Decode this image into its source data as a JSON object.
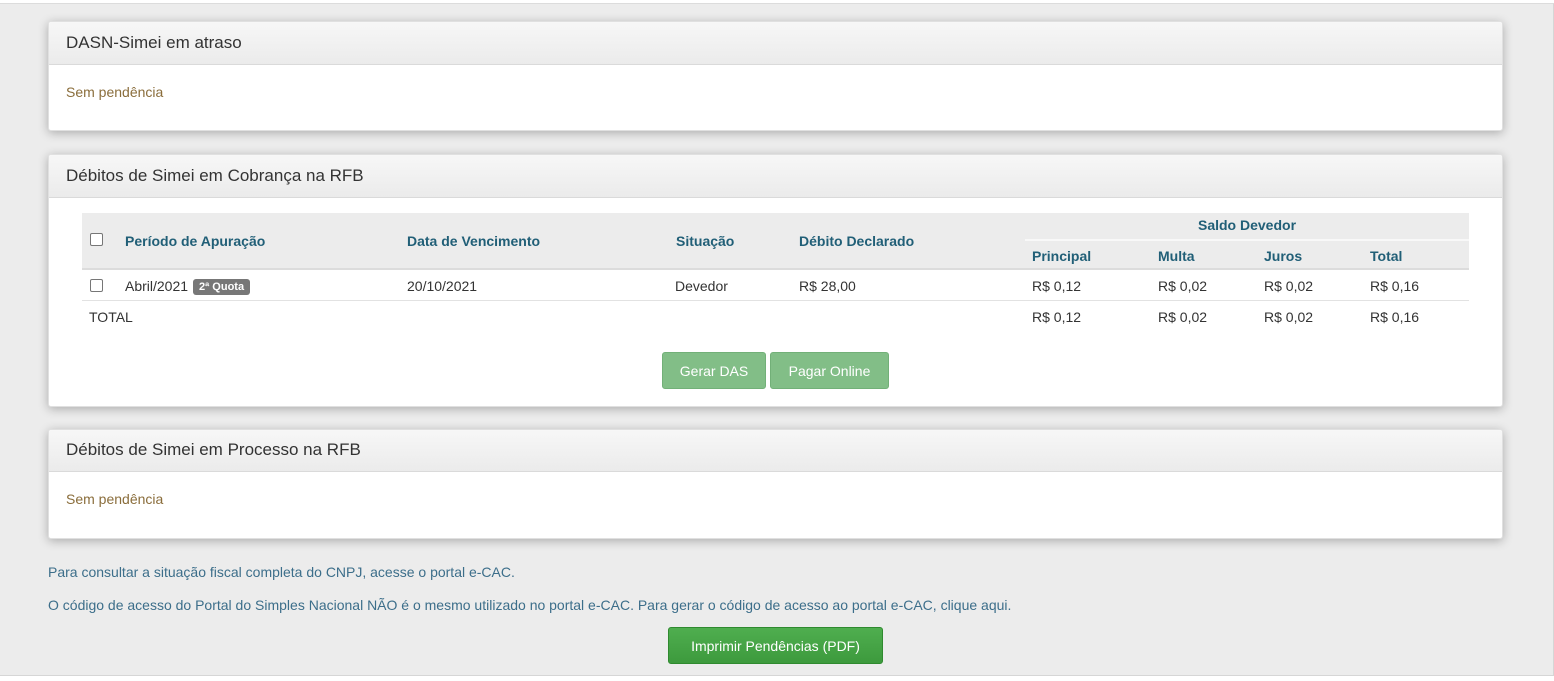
{
  "panel_dasn": {
    "title": "DASN-Simei em atraso",
    "message": "Sem pendência"
  },
  "panel_cobranca": {
    "title": "Débitos de Simei em Cobrança na RFB",
    "columns": {
      "periodo": "Período de Apuração",
      "vencimento": "Data de Vencimento",
      "situacao": "Situação",
      "declarado": "Débito Declarado",
      "saldo_group": "Saldo Devedor",
      "principal": "Principal",
      "multa": "Multa",
      "juros": "Juros",
      "total": "Total"
    },
    "rows": [
      {
        "periodo": "Abril/2021",
        "badge": "2ª Quota",
        "vencimento": "20/10/2021",
        "situacao": "Devedor",
        "declarado": "R$ 28,00",
        "principal": "R$ 0,12",
        "multa": "R$ 0,02",
        "juros": "R$ 0,02",
        "total": "R$ 0,16"
      }
    ],
    "totals": {
      "label": "TOTAL",
      "principal": "R$ 0,12",
      "multa": "R$ 0,02",
      "juros": "R$ 0,02",
      "total": "R$ 0,16"
    },
    "buttons": {
      "gerar_das": "Gerar DAS",
      "pagar_online": "Pagar Online"
    }
  },
  "panel_processo": {
    "title": "Débitos de Simei em Processo na RFB",
    "message": "Sem pendência"
  },
  "notes": {
    "ecac": "Para consultar a situação fiscal completa do CNPJ, acesse o portal e-CAC.",
    "codigo": "O código de acesso do Portal do Simples Nacional NÃO é o mesmo utilizado no portal e-CAC. Para gerar o código de acesso ao portal e-CAC, clique aqui."
  },
  "print_button": "Imprimir Pendências (PDF)"
}
